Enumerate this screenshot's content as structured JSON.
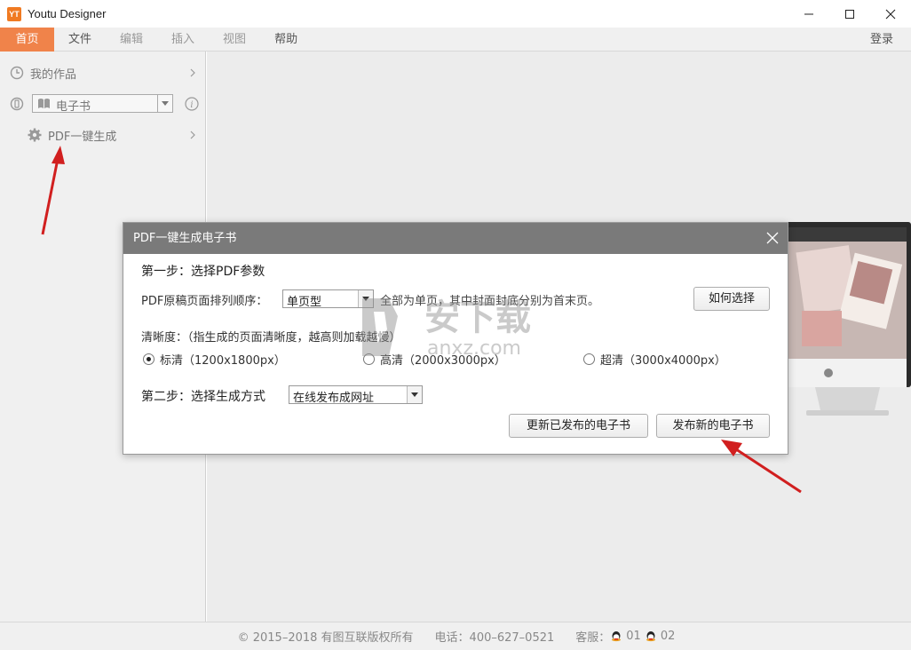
{
  "window": {
    "logo_text": "YT",
    "title": "Youtu Designer"
  },
  "menu": {
    "items": [
      {
        "label": "首页",
        "state": "active"
      },
      {
        "label": "文件",
        "state": "normal"
      },
      {
        "label": "编辑",
        "state": "disabled"
      },
      {
        "label": "插入",
        "state": "disabled"
      },
      {
        "label": "视图",
        "state": "disabled"
      },
      {
        "label": "帮助",
        "state": "normal"
      }
    ],
    "login_label": "登录"
  },
  "sidebar": {
    "my_works_label": "我的作品",
    "category_select_value": "电子书",
    "pdf_generate_label": "PDF一键生成"
  },
  "dialog": {
    "title": "PDF一键生成电子书",
    "step1_title": "第一步：选择PDF参数",
    "page_order_label": "PDF原稿页面排列顺序：",
    "page_order_value": "单页型",
    "page_order_hint": "全部为单页，其中封面封底分别为首末页。",
    "how_to_choose_label": "如何选择",
    "clarity_label": "清晰度：（指生成的页面清晰度，越高则加载越慢）",
    "clarity_options": [
      {
        "label": "标清（1200x1800px）",
        "checked": true
      },
      {
        "label": "高清（2000x3000px）",
        "checked": false
      },
      {
        "label": "超清（3000x4000px）",
        "checked": false
      }
    ],
    "step2_title": "第二步：选择生成方式",
    "method_value": "在线发布成网址",
    "update_published_label": "更新已发布的电子书",
    "publish_new_label": "发布新的电子书"
  },
  "footer": {
    "copyright": "© 2015–2018 有图互联版权所有",
    "phone": "电话：400–627–0521",
    "support_label": "客服：",
    "support_1": "01",
    "support_2": "02"
  },
  "watermark": {
    "text_cn": "安下载",
    "text_en": "anxz.com"
  },
  "colors": {
    "accent": "#f0834a",
    "dialog_header": "#7a7a7a",
    "annotation_arrow": "#d11f1f"
  }
}
